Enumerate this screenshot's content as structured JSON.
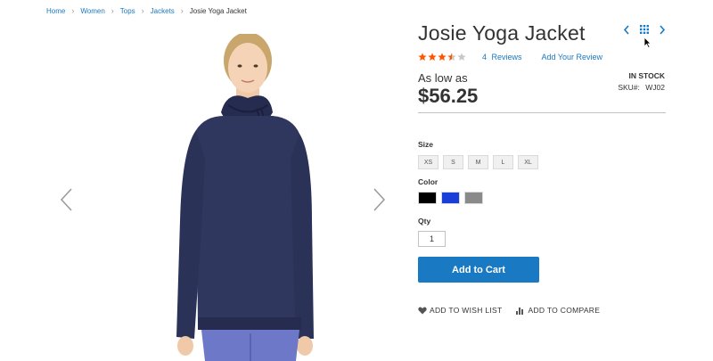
{
  "breadcrumbs": [
    {
      "label": "Home"
    },
    {
      "label": "Women"
    },
    {
      "label": "Tops"
    },
    {
      "label": "Jackets"
    },
    {
      "label": "Josie Yoga Jacket"
    }
  ],
  "product": {
    "title": "Josie Yoga Jacket",
    "rating_fraction": 0.7,
    "reviews_label": "4  Reviews",
    "add_review_label": "Add Your Review",
    "price_prefix": "As low as",
    "price": "$56.25",
    "stock_status": "In stock",
    "sku_label": "SKU#:",
    "sku_value": "WJ02"
  },
  "options": {
    "size_label": "Size",
    "sizes": [
      "XS",
      "S",
      "M",
      "L",
      "XL"
    ],
    "color_label": "Color",
    "colors": [
      {
        "name": "Black",
        "hex": "#000000"
      },
      {
        "name": "Blue",
        "hex": "#1a3ed8"
      },
      {
        "name": "Gray",
        "hex": "#8a8a8a"
      }
    ],
    "qty_label": "Qty",
    "qty_value": "1"
  },
  "actions": {
    "add_to_cart": "Add to Cart",
    "wish_list": "Add to Wish List",
    "compare": "Add to Compare"
  },
  "colors": {
    "accent": "#1979c3",
    "star_filled": "#ff5501",
    "star_empty": "#c7c7c7"
  },
  "icons": {
    "gallery_prev": "chevron-left-icon",
    "gallery_next": "chevron-right-icon",
    "product_prev": "chevron-left-icon",
    "product_grid": "grid-icon",
    "product_next": "chevron-right-icon",
    "wish_list": "heart-icon",
    "compare": "bar-chart-icon"
  }
}
